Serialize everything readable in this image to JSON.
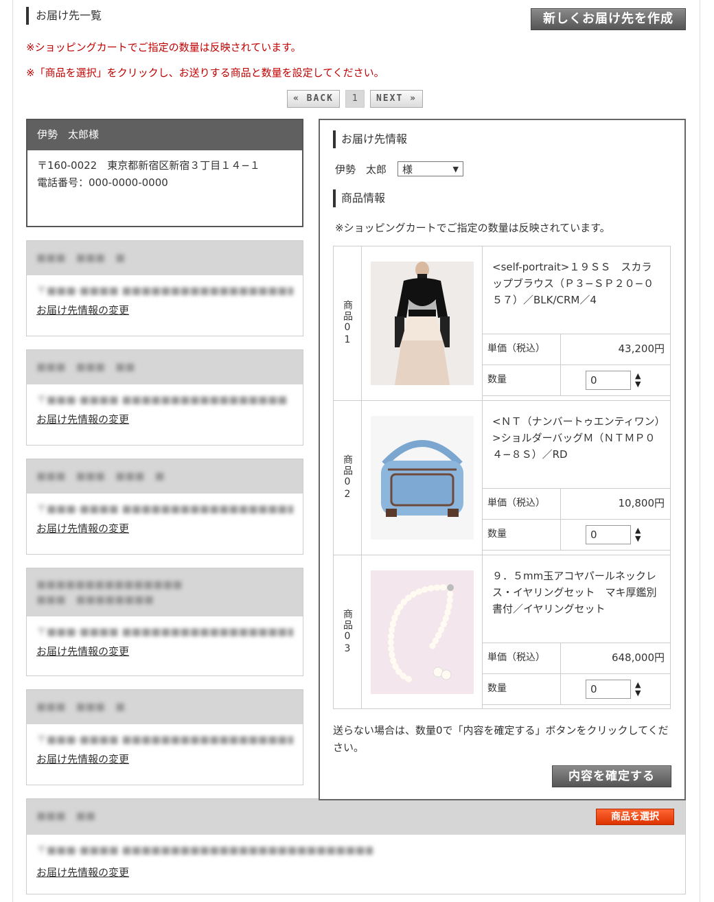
{
  "header": {
    "title": "お届け先一覧",
    "new_button": "新しくお届け先を作成",
    "notice1": "※ショッピングカートでご指定の数量は反映されています。",
    "notice2": "※「商品を選択」をクリックし、お送りする商品と数量を設定してください。"
  },
  "pager": {
    "back": "« BACK",
    "page": "1",
    "next": "NEXT »"
  },
  "active_card": {
    "name": "伊勢　太郎様",
    "address": "〒160-0022　東京都新宿区新宿３丁目１４−１",
    "phone": "電話番号：000-0000-0000"
  },
  "change_link": "お届け先情報の変更",
  "select_button": "商品を選択",
  "panel": {
    "title_recipient": "お届け先情報",
    "recipient_name": "伊勢　太郎",
    "honorific": "様",
    "title_items": "商品情報",
    "note": "※ショッピングカートでご指定の数量は反映されています。",
    "price_label": "単価（税込）",
    "qty_label": "数量",
    "items": [
      {
        "num": "商品01",
        "name": "<self-portrait>１９ＳＳ　スカラップブラウス（Ｐ３−ＳＰ２０−０５７）／BLK/CRM／4",
        "price": "43,200円",
        "qty": "0"
      },
      {
        "num": "商品02",
        "name": "<ＮＴ（ナンバートゥエンティワン）>ショルダーバッグＭ（ＮＴＭＰ０４−８Ｓ）／RD",
        "price": "10,800円",
        "qty": "0"
      },
      {
        "num": "商品03",
        "name": "９．５mm玉アコヤパールネックレス・イヤリングセット　マキ厚鑑別書付／イヤリングセット",
        "price": "648,000円",
        "qty": "0"
      }
    ],
    "footer_note": "送らない場合は、数量0で「内容を確定する」ボタンをクリックしてください。",
    "confirm_button": "内容を確定する"
  }
}
